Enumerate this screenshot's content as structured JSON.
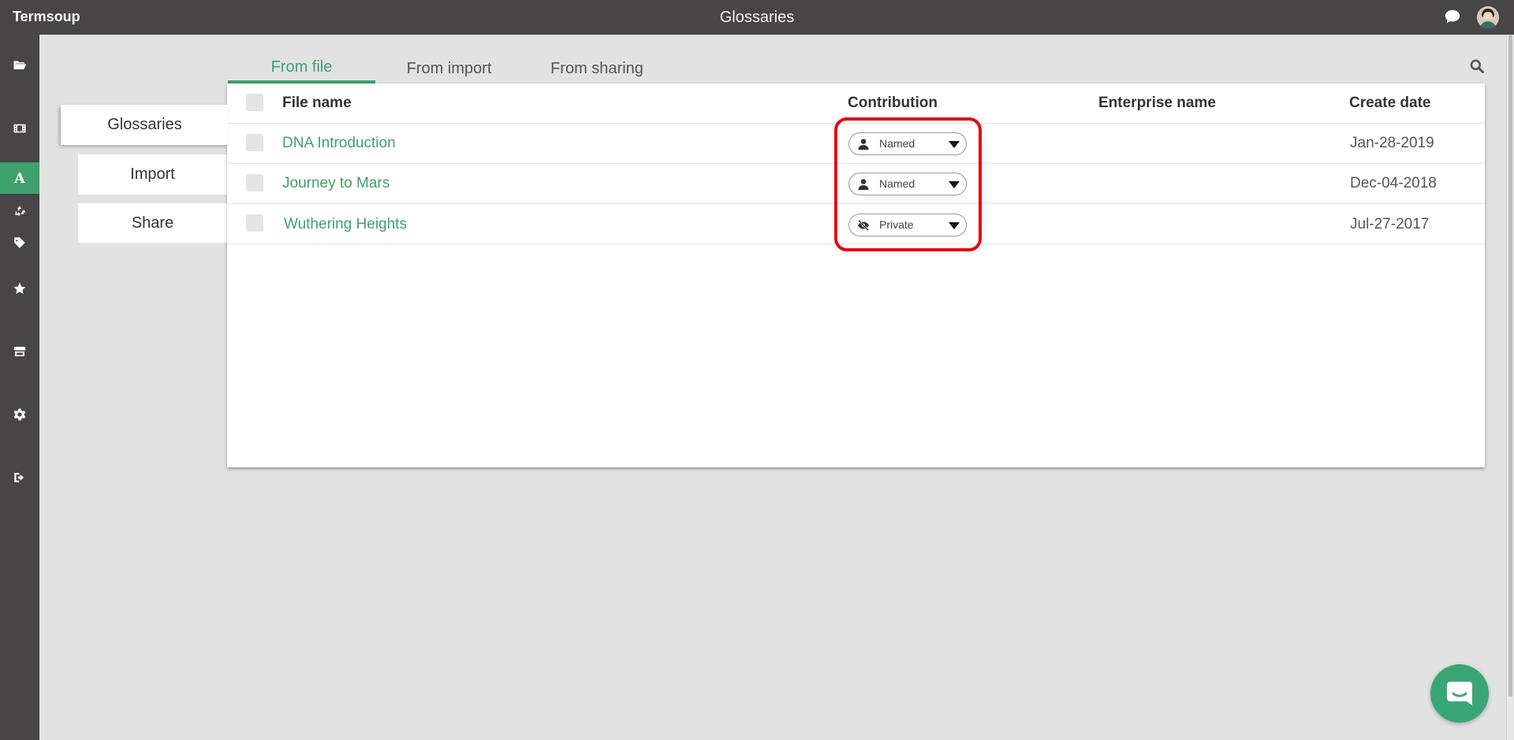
{
  "app": {
    "brand": "Termsoup",
    "page_title": "Glossaries"
  },
  "colors": {
    "accent": "#3ea06b",
    "topbar": "#474546",
    "highlight": "#e30613",
    "background": "#e2e2e2"
  },
  "sidebar": {
    "items": [
      {
        "icon": "folder-open-icon"
      },
      {
        "icon": "film-icon"
      },
      {
        "icon": "glossary-a-icon",
        "label": "A",
        "active": true
      },
      {
        "icon": "recycle-icon"
      },
      {
        "icon": "tag-icon"
      },
      {
        "icon": "star-icon"
      },
      {
        "icon": "store-icon"
      },
      {
        "icon": "gear-icon"
      },
      {
        "icon": "logout-icon"
      }
    ]
  },
  "subnav": {
    "items": [
      {
        "label": "Glossaries",
        "selected": true
      },
      {
        "label": "Import",
        "selected": false
      },
      {
        "label": "Share",
        "selected": false
      }
    ]
  },
  "tabs": [
    {
      "label": "From  file",
      "active": true
    },
    {
      "label": "From  import",
      "active": false
    },
    {
      "label": "From  sharing",
      "active": false
    }
  ],
  "table": {
    "headers": {
      "file_name": "File  name",
      "contribution": "Contribution",
      "enterprise": "Enterprise  name",
      "create_date": "Create  date"
    },
    "rows": [
      {
        "file_name": "DNA Introduction",
        "contribution": "Named",
        "contribution_icon": "user-icon",
        "enterprise": "",
        "create_date": "Jan-28-2019"
      },
      {
        "file_name": "Journey to Mars",
        "contribution": "Named",
        "contribution_icon": "user-icon",
        "enterprise": "",
        "create_date": "Dec-04-2018"
      },
      {
        "file_name": "Wuthering Heights",
        "contribution": "Private",
        "contribution_icon": "eye-slash-icon",
        "enterprise": "",
        "create_date": "Jul-27-2017"
      }
    ]
  }
}
